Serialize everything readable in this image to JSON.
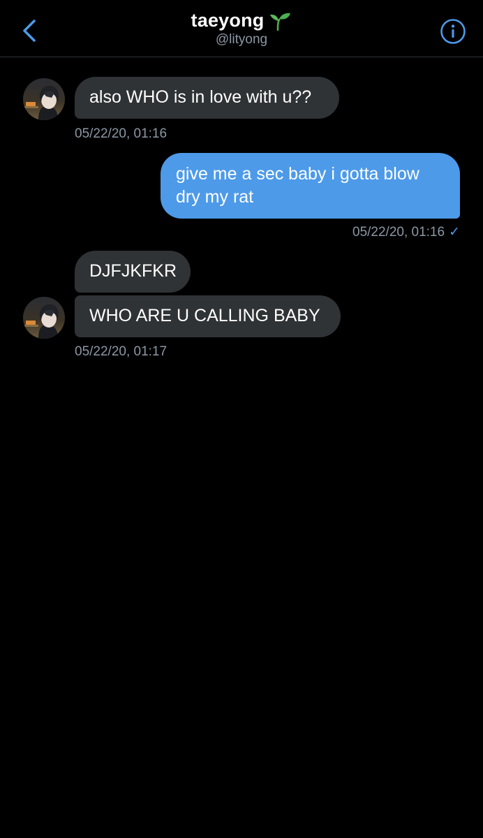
{
  "header": {
    "title": "taeyong",
    "handle": "@lityong",
    "title_emoji": "seedling-icon"
  },
  "colors": {
    "accent": "#4d9ae9",
    "received_bubble": "#2f3336",
    "secondary_text": "#8b98a5",
    "background": "#000000"
  },
  "messages": [
    {
      "direction": "received",
      "text": "also WHO is in love with u??",
      "timestamp": "05/22/20, 01:16"
    },
    {
      "direction": "sent",
      "text": "give me a sec baby i gotta blow dry my rat",
      "timestamp": "05/22/20, 01:16",
      "status": "✓"
    },
    {
      "direction": "received",
      "text": "DJFJKFKR"
    },
    {
      "direction": "received",
      "text": "WHO ARE U CALLING BABY",
      "timestamp": "05/22/20, 01:17"
    }
  ]
}
